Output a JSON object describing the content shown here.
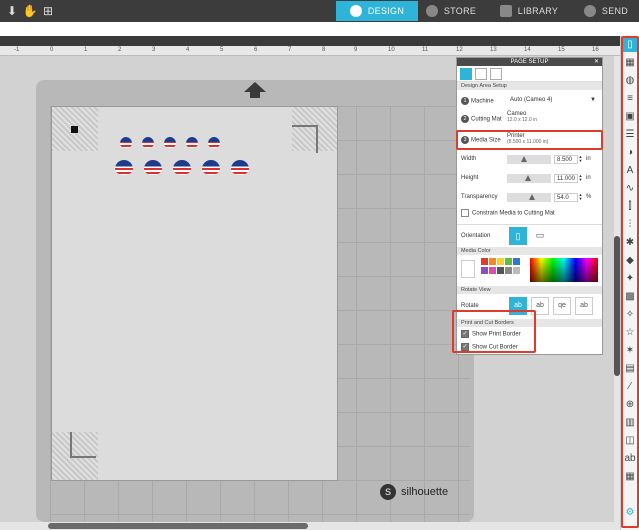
{
  "topbar": {
    "nav": [
      {
        "label": "DESIGN",
        "active": true
      },
      {
        "label": "STORE",
        "active": false
      },
      {
        "label": "LIBRARY",
        "active": false
      },
      {
        "label": "SEND",
        "active": false
      }
    ],
    "accent": "#2fb4d9"
  },
  "ruler": {
    "ticks": [
      "-1",
      "0",
      "1",
      "2",
      "3",
      "4",
      "5",
      "6",
      "7",
      "8",
      "9",
      "10",
      "11",
      "12",
      "13",
      "14",
      "15",
      "16"
    ]
  },
  "logo": {
    "text": "silhouette"
  },
  "page_setup": {
    "title": "PAGE SETUP",
    "close": "✕",
    "design_area_heading": "Design Area Setup",
    "machine": {
      "num": "1",
      "label": "Machine",
      "value": "Auto (Cameo 4)"
    },
    "cutting_mat": {
      "num": "2",
      "label": "Cutting Mat",
      "value": "Cameo",
      "sub": "12.0 x 12.0 in"
    },
    "media_size": {
      "num": "3",
      "label": "Media Size",
      "value": "Printer",
      "sub": "(8.500 x 11.000 in)"
    },
    "width": {
      "label": "Width",
      "value": "8.500",
      "unit": "in"
    },
    "height": {
      "label": "Height",
      "value": "11.000",
      "unit": "in"
    },
    "transparency": {
      "label": "Transparency",
      "value": "54.0",
      "unit": "%"
    },
    "constrain": {
      "label": "Constrain Media to Cutting Mat",
      "checked": false
    },
    "orientation_label": "Orientation",
    "media_color_heading": "Media Color",
    "rotate_view_heading": "Rotate View",
    "rotate_label": "Rotate",
    "borders_heading": "Print and Cut Borders",
    "show_print_border": {
      "label": "Show Print Border",
      "checked": true
    },
    "show_cut_border": {
      "label": "Show Cut Border",
      "checked": true
    }
  },
  "colors": {
    "swatches": [
      "#ffffff",
      "#e03a2a",
      "#f08a24",
      "#f5d12b",
      "#5bbf3b",
      "#2f78d1",
      "#8a4fbf",
      "#d94fa8",
      "#555555",
      "#888888",
      "#bbbbbb",
      "#000000"
    ],
    "highlight": "#e03a2a"
  },
  "right_tools": [
    "page-setup",
    "pixscan",
    "fill",
    "line-style",
    "offset",
    "layers",
    "half-circle",
    "text-style",
    "trace",
    "replicate",
    "modify",
    "transform",
    "knife",
    "star",
    "design-store",
    "sketch",
    "effects",
    "weld",
    "library",
    "print-cut",
    "warp",
    "text",
    "help"
  ]
}
